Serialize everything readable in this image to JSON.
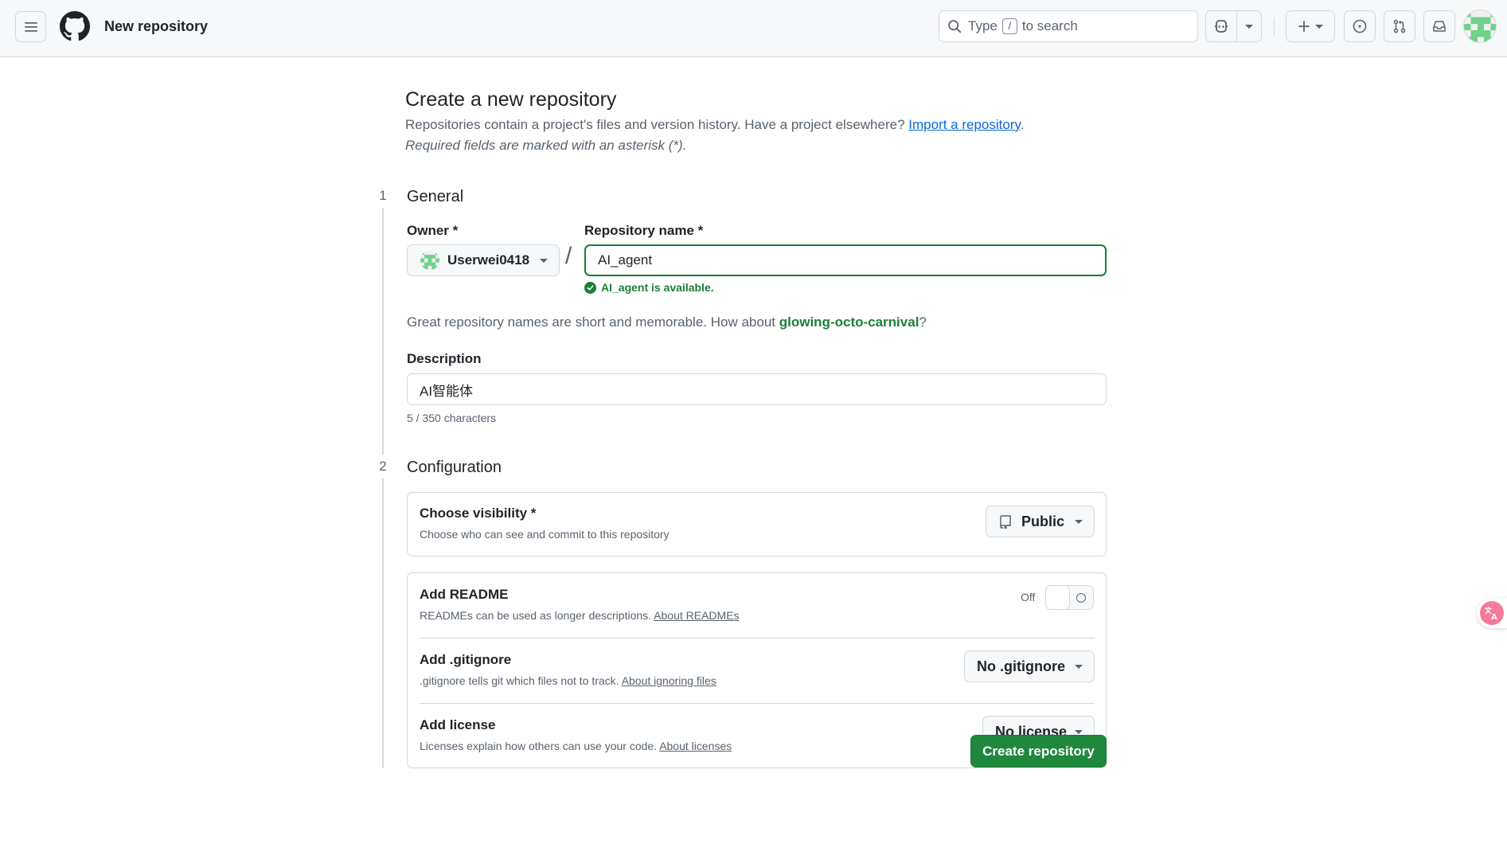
{
  "header": {
    "page_title": "New repository",
    "search": {
      "prefix": "Type",
      "key": "/",
      "suffix": "to search"
    }
  },
  "intro": {
    "title": "Create a new repository",
    "text": "Repositories contain a project's files and version history. Have a project elsewhere? ",
    "import_link": "Import a repository",
    "period": ".",
    "required_note": "Required fields are marked with an asterisk (*)."
  },
  "general": {
    "step": "1",
    "title": "General",
    "owner_label": "Owner *",
    "owner_value": "Userwei0418",
    "slash": "/",
    "repo_label": "Repository name *",
    "repo_value": "AI_agent",
    "availability": "AI_agent is available.",
    "suggestion_prefix": "Great repository names are short and memorable. How about ",
    "suggestion_name": "glowing-octo-carnival",
    "suggestion_suffix": "?",
    "description_label": "Description",
    "description_value": "AI智能体",
    "char_count": "5 / 350 characters"
  },
  "configuration": {
    "step": "2",
    "title": "Configuration",
    "visibility": {
      "title": "Choose visibility *",
      "subtitle": "Choose who can see and commit to this repository",
      "value": "Public"
    },
    "readme": {
      "title": "Add README",
      "subtitle": "READMEs can be used as longer descriptions. ",
      "link": "About READMEs",
      "toggle_label": "Off",
      "enabled": false
    },
    "gitignore": {
      "title": "Add .gitignore",
      "subtitle": ".gitignore tells git which files not to track. ",
      "link": "About ignoring files",
      "value": "No .gitignore"
    },
    "license": {
      "title": "Add license",
      "subtitle": "Licenses explain how others can use your code. ",
      "link": "About licenses",
      "value": "No license"
    }
  },
  "submit_label": "Create repository",
  "colors": {
    "primary_green": "#1f883d",
    "success_green": "#1a7f37",
    "link_blue": "#0969da",
    "border": "#d1d9e0"
  }
}
